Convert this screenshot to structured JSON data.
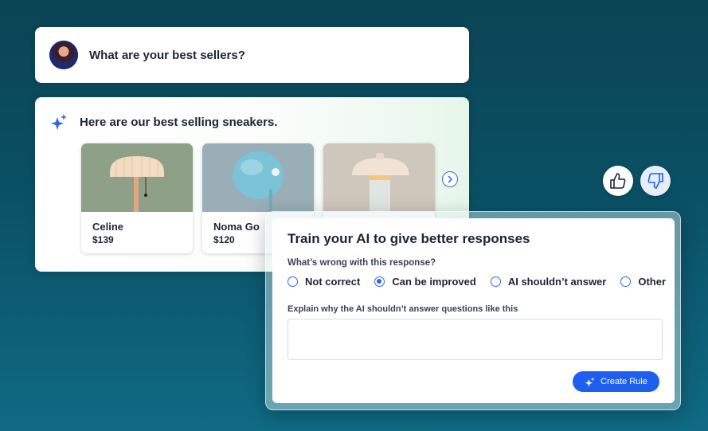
{
  "chat": {
    "question": "What are your best sellers?",
    "answer": "Here are our best selling sneakers.",
    "products": [
      {
        "name": "Celine",
        "price": "$139"
      },
      {
        "name": "Noma Go",
        "price": "$120"
      },
      {
        "name": "",
        "price": ""
      }
    ]
  },
  "icons": {
    "avatar": "user-avatar",
    "sparkle": "sparkle-icon",
    "next": "chevron-right-icon",
    "thumb_up": "thumb-up-icon",
    "thumb_down": "thumb-down-icon"
  },
  "train": {
    "title": "Train your AI to give better responses",
    "question": "What’s wrong with this response?",
    "options": [
      {
        "label": "Not correct",
        "selected": false
      },
      {
        "label": "Can be improved",
        "selected": true
      },
      {
        "label": "AI shouldn’t answer",
        "selected": false
      },
      {
        "label": "Other",
        "selected": false
      }
    ],
    "explain_label": "Explain why the AI shouldn’t answer questions like this",
    "explain_value": "",
    "create_rule_label": "Create Rule"
  },
  "colors": {
    "accent": "#1f5ff0",
    "background": "#0a5064"
  }
}
